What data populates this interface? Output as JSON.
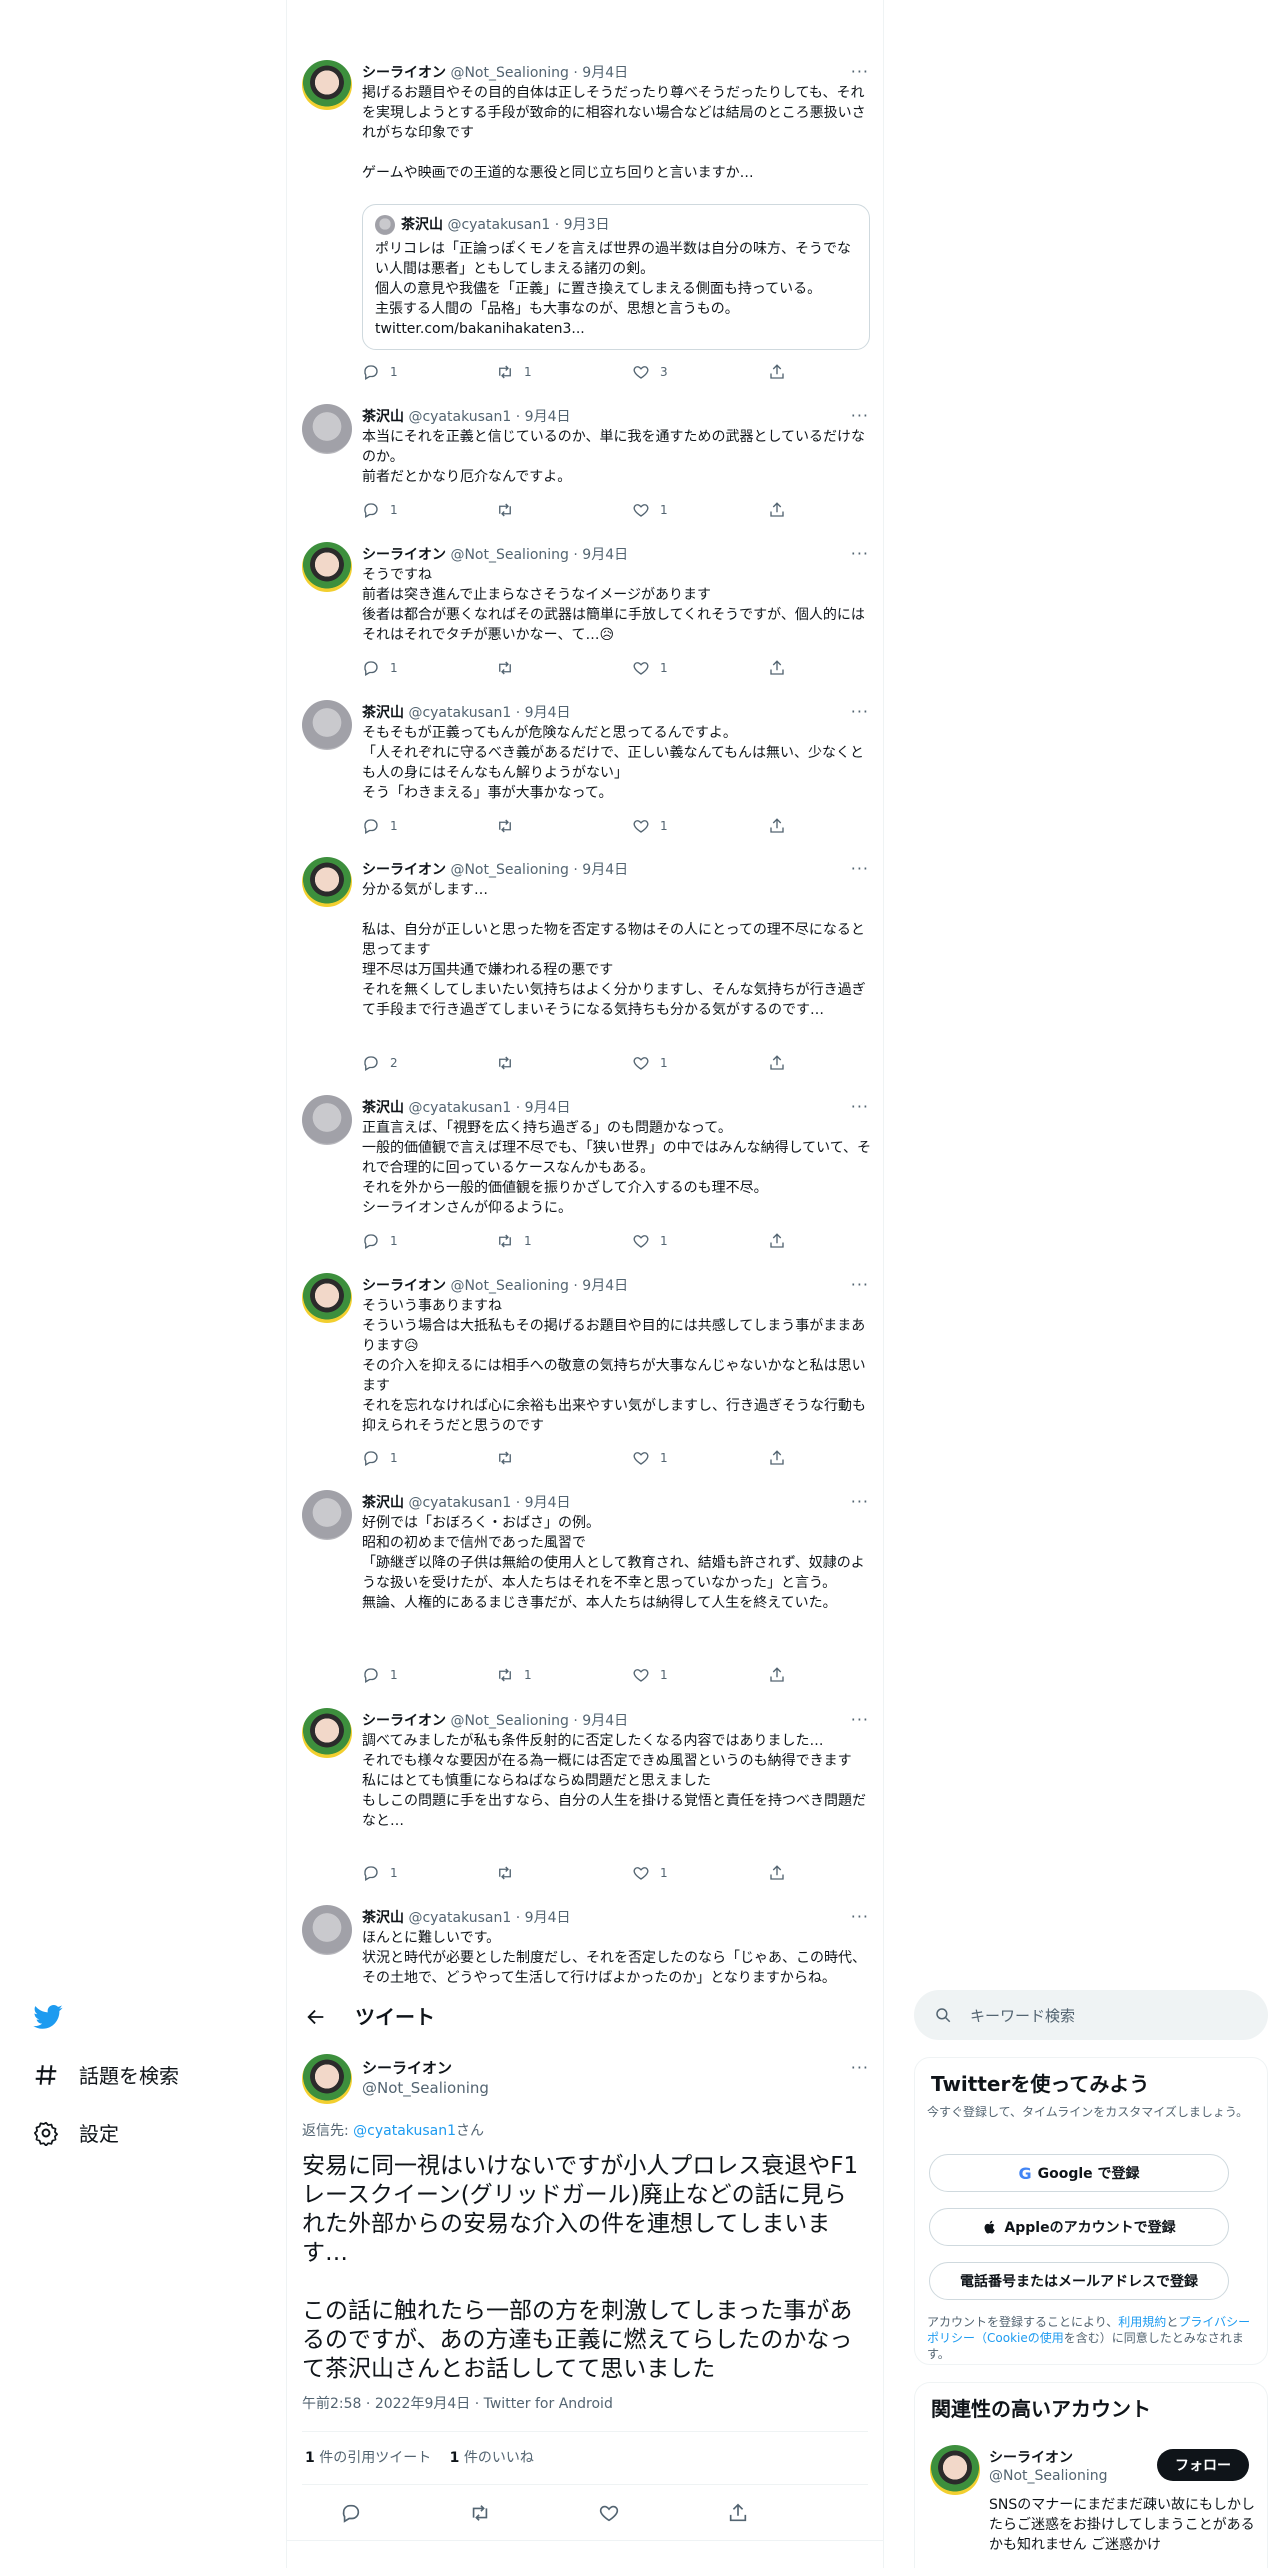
{
  "timeline": {
    "tweets": [
      {
        "name": "シーライオン",
        "handle": "@Not_Sealioning",
        "date": "9月4日",
        "text": "掲げるお題目やその目的自体は正しそうだったり尊べそうだったりしても、それを実現しようとする手段が致命的に相容れない場合などは結局のところ悪扱いされがちな印象です\n\nゲームや映画での王道的な悪役と同じ立ち回りと言いますか…",
        "quote": {
          "name": "茶沢山",
          "handle": "@cyatakusan1",
          "date": "9月3日",
          "text": "ポリコレは「正論っぽくモノを言えば世界の過半数は自分の味方、そうでない人間は悪者」ともしてしまえる諸刃の剣。\n個人の意見や我儘を「正義」に置き換えてしまえる側面も持っている。\n主張する人間の「品格」も大事なのが、思想と言うもの。\ntwitter.com/bakanihakaten3..."
        },
        "replies": "1",
        "retweets": "1",
        "likes": "3"
      },
      {
        "name": "茶沢山",
        "handle": "@cyatakusan1",
        "date": "9月4日",
        "text": "本当にそれを正義と信じているのか、単に我を通すための武器としているだけなのか。\n前者だとかなり厄介なんですよ。",
        "replies": "1",
        "retweets": "",
        "likes": "1"
      },
      {
        "name": "シーライオン",
        "handle": "@Not_Sealioning",
        "date": "9月4日",
        "text": "そうですね\n前者は突き進んで止まらなさそうなイメージがあります\n後者は都合が悪くなればその武器は簡単に手放してくれそうですが、個人的にはそれはそれでタチが悪いかなー、て…😥",
        "replies": "1",
        "retweets": "",
        "likes": "1"
      },
      {
        "name": "茶沢山",
        "handle": "@cyatakusan1",
        "date": "9月4日",
        "text": "そもそもが正義ってもんが危険なんだと思ってるんですよ。\n「人それぞれに守るべき義があるだけで、正しい義なんてもんは無い、少なくとも人の身にはそんなもん解りようがない」\nそう「わきまえる」事が大事かなって。",
        "replies": "1",
        "retweets": "",
        "likes": "1"
      },
      {
        "name": "シーライオン",
        "handle": "@Not_Sealioning",
        "date": "9月4日",
        "text": "分かる気がします…\n\n私は、自分が正しいと思った物を否定する物はその人にとっての理不尽になると思ってます\n理不尽は万国共通で嫌われる程の悪です\nそれを無くしてしまいたい気持ちはよく分かりますし、そんな気持ちが行き過ぎて手段まで行き過ぎてしまいそうになる気持ちも分かる気がするのです…",
        "replies": "2",
        "retweets": "",
        "likes": "1"
      },
      {
        "name": "茶沢山",
        "handle": "@cyatakusan1",
        "date": "9月4日",
        "text": "正直言えば、「視野を広く持ち過ぎる」のも問題かなって。\n一般的価値観で言えば理不尽でも、「狭い世界」の中ではみんな納得していて、それで合理的に回っているケースなんかもある。\nそれを外から一般的価値観を振りかざして介入するのも理不尽。\nシーライオンさんが仰るように。",
        "replies": "1",
        "retweets": "1",
        "likes": "1"
      },
      {
        "name": "シーライオン",
        "handle": "@Not_Sealioning",
        "date": "9月4日",
        "text": "そういう事ありますね\nそういう場合は大抵私もその掲げるお題目や目的には共感してしまう事がままあります😥\nその介入を抑えるには相手への敬意の気持ちが大事なんじゃないかなと私は思います\nそれを忘れなければ心に余裕も出来やすい気がしますし、行き過ぎそうな行動も抑えられそうだと思うのです",
        "replies": "1",
        "retweets": "",
        "likes": "1"
      },
      {
        "name": "茶沢山",
        "handle": "@cyatakusan1",
        "date": "9月4日",
        "text": "好例では「おぼろく・おばさ」の例。\n昭和の初めまで信州であった風習で\n「跡継ぎ以降の子供は無給の使用人として教育され、結婚も許されず、奴隷のような扱いを受けたが、本人たちはそれを不幸と思っていなかった」と言う。\n無論、人権的にあるまじき事だが、本人たちは納得して人生を終えていた。",
        "replies": "1",
        "retweets": "1",
        "likes": "1"
      },
      {
        "name": "シーライオン",
        "handle": "@Not_Sealioning",
        "date": "9月4日",
        "text": "調べてみましたが私も条件反射的に否定したくなる内容ではありました…\nそれでも様々な要因が在る為一概には否定できぬ風習というのも納得できます\n私にはとても慎重にならねばならぬ問題だと思えました\nもしこの問題に手を出すなら、自分の人生を掛ける覚悟と責任を持つべき問題だなと…",
        "replies": "1",
        "retweets": "",
        "likes": "1"
      },
      {
        "name": "茶沢山",
        "handle": "@cyatakusan1",
        "date": "9月4日",
        "text": "ほんとに難しいです。\n状況と時代が必要とした制度だし、それを否定したのなら「じゃあ、この時代、その土地で、どうやって生活して行けばよかったのか」となりますからね。",
        "replies": "",
        "retweets": "",
        "likes": ""
      }
    ]
  },
  "nav": {
    "explore": "話題を検索",
    "settings": "設定"
  },
  "detail": {
    "header_title": "ツイート",
    "name": "シーライオン",
    "handle": "@Not_Sealioning",
    "reply_prefix": "返信先: ",
    "reply_to": "@cyatakusan1",
    "reply_suffix": "さん",
    "text": "安易に同一視はいけないですが小人プロレス衰退やF1レースクイーン(グリッドガール)廃止などの話に見られた外部からの安易な介入の件を連想してしまいます…\n\nこの話に触れたら一部の方を刺激してしまった事があるのですが、あの方達も正義に燃えてらしたのかなって茶沢山さんとお話ししてて思いました",
    "time": "午前2:58",
    "date": "2022年9月4日",
    "source": "Twitter for Android",
    "quote_count": "1",
    "quote_label": "件の引用ツイート",
    "like_count": "1",
    "like_label": "件のいいね"
  },
  "right": {
    "search_placeholder": "キーワード検索",
    "signup": {
      "title": "Twitterを使ってみよう",
      "subtitle": "今すぐ登録して、タイムラインをカスタマイズしましょう。",
      "google": "Google で登録",
      "apple": "Appleのアカウントで登録",
      "phone": "電話番号またはメールアドレスで登録",
      "terms_pre": "アカウントを登録することにより、",
      "terms_link": "利用規約",
      "terms_mid": "と",
      "privacy_link": "プライバシーポリシー（Cookieの使用",
      "terms_post": "を含む）に同意したとみなされます。"
    },
    "related": {
      "title": "関連性の高いアカウント",
      "name": "シーライオン",
      "handle": "@Not_Sealioning",
      "follow": "フォロー",
      "bio": "SNSのマナーにまだまだ疎い故にもしかしたらご迷惑をお掛けしてしまうことがあるかも知れません ご迷惑かけ"
    }
  },
  "colors": {
    "accent": "#1d9bf0",
    "text": "#0f1419",
    "muted": "#536471",
    "border": "#eff3f4"
  }
}
